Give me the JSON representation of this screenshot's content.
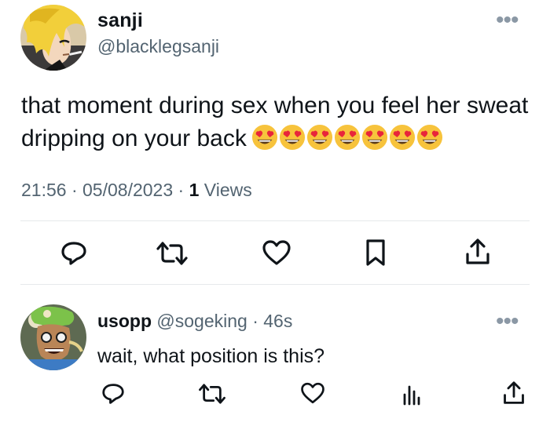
{
  "main_tweet": {
    "author_name": "sanji",
    "author_handle": "@blacklegsanji",
    "avatar_icon": "sanji-avatar",
    "more_label": "•••",
    "text": "that moment during sex when you feel her sweat dripping on your back",
    "emoji": [
      "heart-eyes-emoji",
      "heart-eyes-emoji",
      "heart-eyes-emoji",
      "heart-eyes-emoji",
      "heart-eyes-emoji",
      "heart-eyes-emoji",
      "heart-eyes-emoji"
    ],
    "time": "21:56",
    "date": "05/08/2023",
    "views_count": "1",
    "views_label": "Views",
    "separator": "·",
    "actions": [
      "reply-icon",
      "retweet-icon",
      "like-icon",
      "bookmark-icon",
      "share-icon"
    ]
  },
  "reply_tweet": {
    "author_name": "usopp",
    "author_handle": "@sogeking",
    "separator": "·",
    "time": "46s",
    "avatar_icon": "usopp-avatar",
    "more_label": "•••",
    "text": "wait, what position is this?",
    "actions": [
      "reply-icon",
      "retweet-icon",
      "like-icon",
      "analytics-icon",
      "share-icon"
    ]
  },
  "colors": {
    "text_primary": "#0f1419",
    "text_secondary": "#536471",
    "divider": "#e6e9eb",
    "emoji_face": "#f7c33c",
    "emoji_heart": "#e8253b"
  }
}
